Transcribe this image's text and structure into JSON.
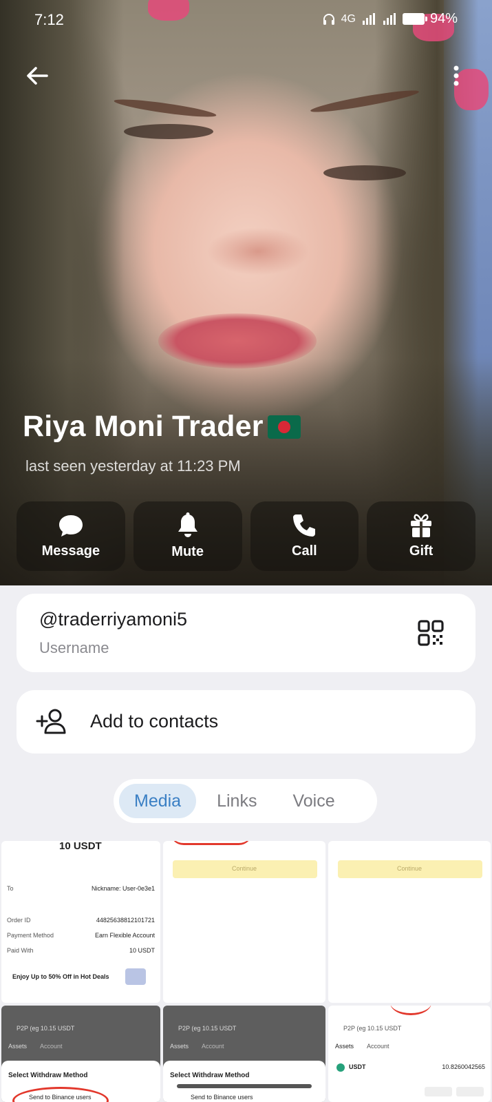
{
  "status_bar": {
    "time": "7:12",
    "network": "4G",
    "battery": "94%"
  },
  "profile": {
    "name": "Riya Moni Trader",
    "flag_icon": "bangladesh-flag",
    "last_seen": "last seen yesterday at 11:23 PM"
  },
  "actions": [
    {
      "label": "Message",
      "icon": "message-icon"
    },
    {
      "label": "Mute",
      "icon": "bell-icon"
    },
    {
      "label": "Call",
      "icon": "phone-icon"
    },
    {
      "label": "Gift",
      "icon": "gift-icon"
    }
  ],
  "username": {
    "value": "@traderriyamoni5",
    "label": "Username"
  },
  "contacts": {
    "label": "Add to contacts"
  },
  "tabs": [
    {
      "label": "Media",
      "active": true
    },
    {
      "label": "Links",
      "active": false
    },
    {
      "label": "Voice",
      "active": false
    }
  ],
  "media": {
    "thumb1": {
      "amount": "10 USDT",
      "nickname": "Nickname: User-0e3e1",
      "order_label": "Order ID",
      "order_value": "44825638812101721",
      "payment_label": "Payment Method",
      "payment_value": "Earn Flexible Account",
      "paid_label": "Paid With",
      "paid_value": "10 USDT",
      "promo": "Enjoy Up to 50% Off in Hot Deals"
    },
    "continue_label": "Continue",
    "p2p_label": "P2P (eg 10.15 USDT",
    "assets_label": "Assets",
    "account_label": "Account",
    "withdraw_title": "Select Withdraw Method",
    "send_label": "Send to Binance users",
    "usdt_label": "USDT",
    "usdt_value": "10.8260042565"
  },
  "colors": {
    "accent": "#3a7fc4",
    "tab_active_bg": "#dde9f5",
    "background": "#efeff3"
  }
}
